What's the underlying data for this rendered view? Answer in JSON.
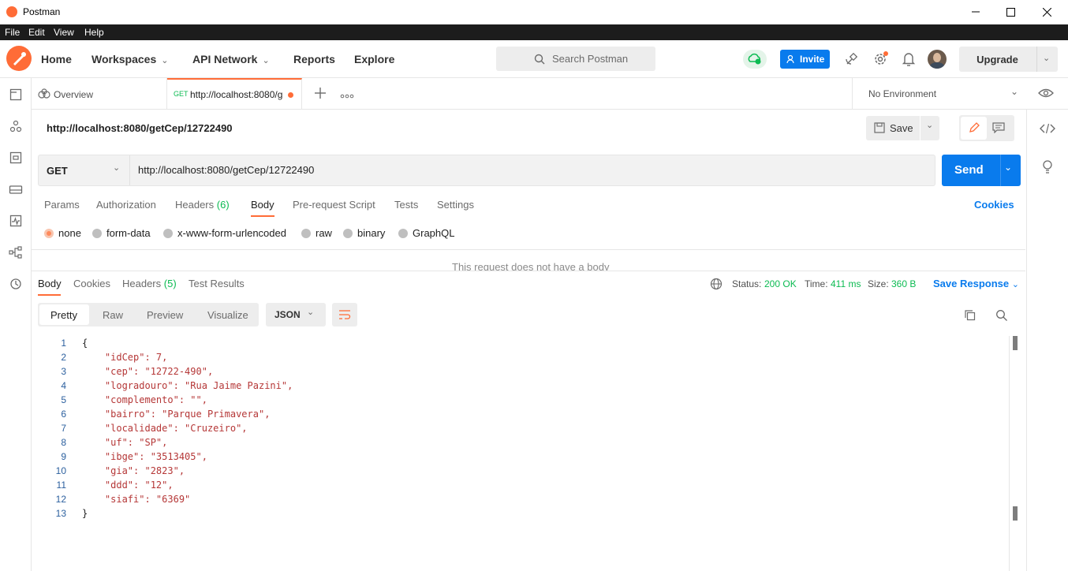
{
  "window": {
    "title": "Postman"
  },
  "menu": [
    "File",
    "Edit",
    "View",
    "Help"
  ],
  "header": {
    "nav": [
      "Home",
      "Workspaces",
      "API Network",
      "Reports",
      "Explore"
    ],
    "search_placeholder": "Search Postman",
    "invite_label": "Invite",
    "upgrade_label": "Upgrade"
  },
  "tabs": {
    "overview": "Overview",
    "active_method": "GET",
    "active_url": "http://localhost:8080/g"
  },
  "environment": "No Environment",
  "request": {
    "name": "http://localhost:8080/getCep/12722490",
    "save_label": "Save",
    "method": "GET",
    "url": "http://localhost:8080/getCep/12722490",
    "send_label": "Send",
    "tabs": [
      "Params",
      "Authorization",
      "Headers",
      "Body",
      "Pre-request Script",
      "Tests",
      "Settings"
    ],
    "headers_count": "(6)",
    "cookies_label": "Cookies",
    "body_types": [
      "none",
      "form-data",
      "x-www-form-urlencoded",
      "raw",
      "binary",
      "GraphQL"
    ],
    "no_body_text": "This request does not have a body"
  },
  "response": {
    "tabs": [
      "Body",
      "Cookies",
      "Headers",
      "Test Results"
    ],
    "headers_count": "(5)",
    "status_label": "Status:",
    "status_value": "200 OK",
    "time_label": "Time:",
    "time_value": "411 ms",
    "size_label": "Size:",
    "size_value": "360 B",
    "save_response": "Save Response",
    "view_tabs": [
      "Pretty",
      "Raw",
      "Preview",
      "Visualize"
    ],
    "format": "JSON",
    "lines": [
      "{",
      "    \"idCep\": 7,",
      "    \"cep\": \"12722-490\",",
      "    \"logradouro\": \"Rua Jaime Pazini\",",
      "    \"complemento\": \"\",",
      "    \"bairro\": \"Parque Primavera\",",
      "    \"localidade\": \"Cruzeiro\",",
      "    \"uf\": \"SP\",",
      "    \"ibge\": \"3513405\",",
      "    \"gia\": \"2823\",",
      "    \"ddd\": \"12\",",
      "    \"siafi\": \"6369\"",
      "}"
    ]
  },
  "colors": {
    "accent": "#ff6c37",
    "primary": "#097bed",
    "success": "#0cbb52"
  }
}
